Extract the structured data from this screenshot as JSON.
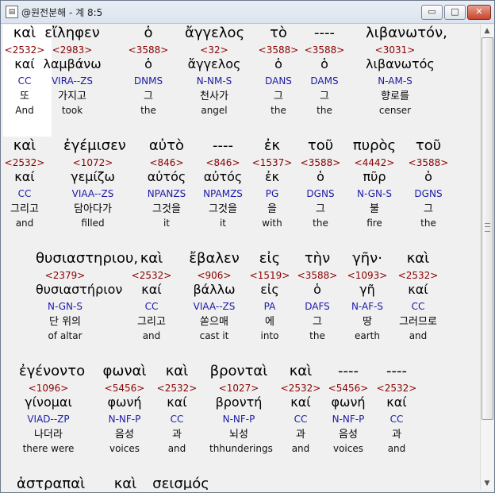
{
  "window": {
    "title": "@원전분해 - 계 8:5",
    "buttons": {
      "minimize": "▭",
      "maximize": "□",
      "close": "✕"
    }
  },
  "rows": [
    {
      "words": [
        {
          "greek": "καὶ",
          "strong": "<2532>",
          "lemma": "καί",
          "morph": "CC",
          "korean": "또",
          "english": "And"
        },
        {
          "greek": "εἴληφεν",
          "strong": "<2983>",
          "lemma": "λαμβάνω",
          "morph": "VIRA--ZS",
          "korean": "가지고",
          "english": "took"
        },
        {
          "greek": "ὁ",
          "strong": "<3588>",
          "lemma": "ὁ",
          "morph": "DNMS",
          "korean": "그",
          "english": "the"
        },
        {
          "greek": "ἄγγελος",
          "strong": "<32>",
          "lemma": "ἄγγελος",
          "morph": "N-NM-S",
          "korean": "천사가",
          "english": "angel"
        },
        {
          "greek": "τὸ",
          "strong": "<3588>",
          "lemma": "ὁ",
          "morph": "DANS",
          "korean": "그",
          "english": "the"
        },
        {
          "greek": "----",
          "strong": "<3588>",
          "lemma": "ὁ",
          "morph": "DAMS",
          "korean": "그",
          "english": "the"
        },
        {
          "greek": "λιβανωτόν,",
          "strong": "<3031>",
          "lemma": "λιβανωτός",
          "morph": "N-AM-S",
          "korean": "향로를",
          "english": "censer"
        }
      ]
    },
    {
      "words": [
        {
          "greek": "καὶ",
          "strong": "<2532>",
          "lemma": "καί",
          "morph": "CC",
          "korean": "그리고",
          "english": "and"
        },
        {
          "greek": "ἐγέμισεν",
          "strong": "<1072>",
          "lemma": "γεμίζω",
          "morph": "VIAA--ZS",
          "korean": "담아다가",
          "english": "filled"
        },
        {
          "greek": "αὐτὸ",
          "strong": "<846>",
          "lemma": "αὐτός",
          "morph": "NPANZS",
          "korean": "그것을",
          "english": "it"
        },
        {
          "greek": "----",
          "strong": "<846>",
          "lemma": "αὐτός",
          "morph": "NPAMZS",
          "korean": "그것을",
          "english": "it"
        },
        {
          "greek": "ἐκ",
          "strong": "<1537>",
          "lemma": "ἐκ",
          "morph": "PG",
          "korean": "을",
          "english": "with"
        },
        {
          "greek": "τοῦ",
          "strong": "<3588>",
          "lemma": "ὁ",
          "morph": "DGNS",
          "korean": "그",
          "english": "the"
        },
        {
          "greek": "πυρὸς",
          "strong": "<4442>",
          "lemma": "πῦρ",
          "morph": "N-GN-S",
          "korean": "불",
          "english": "fire"
        },
        {
          "greek": "τοῦ",
          "strong": "<3588>",
          "lemma": "ὁ",
          "morph": "DGNS",
          "korean": "그",
          "english": "the"
        }
      ]
    },
    {
      "words": [
        {
          "greek": "θυσιαστηριου,",
          "strong": "<2379>",
          "lemma": "θυσιαστήριον",
          "morph": "N-GN-S",
          "korean": "단 위의",
          "english": "of altar"
        },
        {
          "greek": "καὶ",
          "strong": "<2532>",
          "lemma": "καί",
          "morph": "CC",
          "korean": "그리고",
          "english": "and"
        },
        {
          "greek": "ἔβαλεν",
          "strong": "<906>",
          "lemma": "βάλλω",
          "morph": "VIAA--ZS",
          "korean": "쏟으매",
          "english": "cast it"
        },
        {
          "greek": "εἰς",
          "strong": "<1519>",
          "lemma": "εἰς",
          "morph": "PA",
          "korean": "에",
          "english": "into"
        },
        {
          "greek": "τὴν",
          "strong": "<3588>",
          "lemma": "ὁ",
          "morph": "DAFS",
          "korean": "그",
          "english": "the"
        },
        {
          "greek": "γῆν·",
          "strong": "<1093>",
          "lemma": "γῆ",
          "morph": "N-AF-S",
          "korean": "땅",
          "english": "earth"
        },
        {
          "greek": "καὶ",
          "strong": "<2532>",
          "lemma": "καί",
          "morph": "CC",
          "korean": "그러므로",
          "english": "and"
        }
      ]
    },
    {
      "words": [
        {
          "greek": "ἐγένοντο",
          "strong": "<1096>",
          "lemma": "γίνομαι",
          "morph": "VIAD--ZP",
          "korean": "나더라",
          "english": "there were"
        },
        {
          "greek": "φωναὶ",
          "strong": "<5456>",
          "lemma": "φωνή",
          "morph": "N-NF-P",
          "korean": "음성",
          "english": "voices"
        },
        {
          "greek": "καὶ",
          "strong": "<2532>",
          "lemma": "καί",
          "morph": "CC",
          "korean": "과",
          "english": "and"
        },
        {
          "greek": "βρονταὶ",
          "strong": "<1027>",
          "lemma": "βροντή",
          "morph": "N-NF-P",
          "korean": "뇌성",
          "english": "thhunderings"
        },
        {
          "greek": "καὶ",
          "strong": "<2532>",
          "lemma": "καί",
          "morph": "CC",
          "korean": "과",
          "english": "and"
        },
        {
          "greek": "----",
          "strong": "<5456>",
          "lemma": "φωνή",
          "morph": "N-NF-P",
          "korean": "음성",
          "english": "voices"
        },
        {
          "greek": "----",
          "strong": "<2532>",
          "lemma": "καί",
          "morph": "CC",
          "korean": "과",
          "english": "and"
        }
      ]
    },
    {
      "words": [
        {
          "greek": "ἀστραπαὶ"
        },
        {
          "greek": "καὶ"
        },
        {
          "greek": "σεισμός"
        }
      ]
    }
  ]
}
